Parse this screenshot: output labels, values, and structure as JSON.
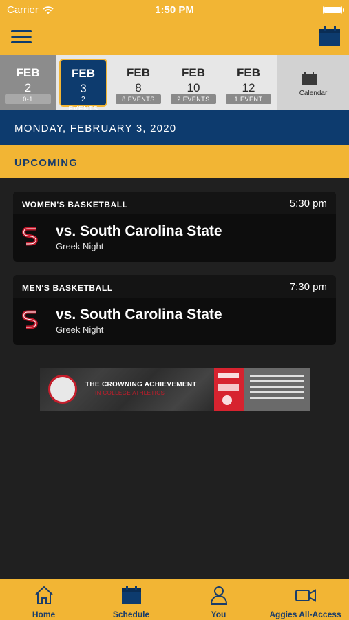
{
  "status_bar": {
    "carrier": "Carrier",
    "time": "1:50 PM"
  },
  "date_strip": {
    "dates": [
      {
        "month": "FEB",
        "day": "2",
        "count": "0-1"
      },
      {
        "month": "FEB",
        "day": "3",
        "count": "2 EVENTS"
      },
      {
        "month": "FEB",
        "day": "8",
        "count": "8 EVENTS"
      },
      {
        "month": "FEB",
        "day": "10",
        "count": "2 EVENTS"
      },
      {
        "month": "FEB",
        "day": "12",
        "count": "1 EVENT"
      }
    ],
    "calendar_label": "Calendar"
  },
  "day_header": "MONDAY, FEBRUARY 3, 2020",
  "section_label": "UPCOMING",
  "events": [
    {
      "sport": "WOMEN'S BASKETBALL",
      "time": "5:30 pm",
      "opponent": "vs. South Carolina State",
      "promo": "Greek Night"
    },
    {
      "sport": "MEN'S BASKETBALL",
      "time": "7:30 pm",
      "opponent": "vs. South Carolina State",
      "promo": "Greek Night"
    }
  ],
  "ad": {
    "headline": "THE CROWNING ACHIEVEMENT",
    "subline": "IN COLLEGE ATHLETICS"
  },
  "tabs": [
    {
      "label": "Home",
      "icon": "home-icon"
    },
    {
      "label": "Schedule",
      "icon": "calendar-icon"
    },
    {
      "label": "You",
      "icon": "person-icon"
    },
    {
      "label": "Aggies All-Access",
      "icon": "video-camera-icon"
    }
  ],
  "colors": {
    "gold": "#f2b534",
    "navy": "#0d3b6e",
    "background": "#202020",
    "card": "#0d0d0d"
  }
}
